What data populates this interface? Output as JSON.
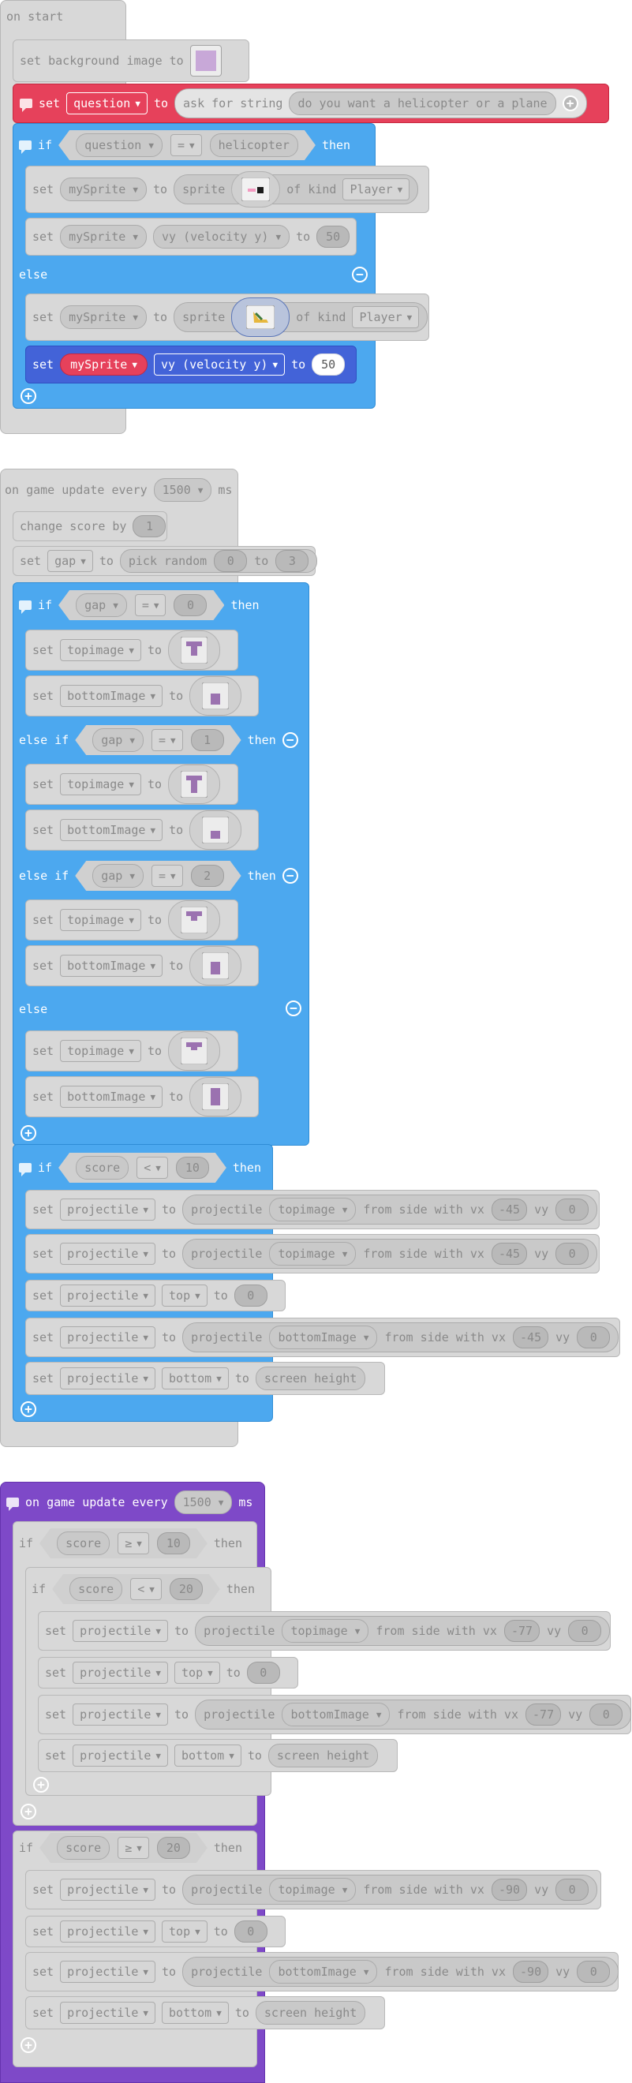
{
  "kw": {
    "set": "set",
    "to": "to",
    "if": "if",
    "then": "then",
    "else": "else",
    "else_if": "else if",
    "of_kind": "of kind",
    "sprite": "sprite",
    "change_score_by": "change score by",
    "pick_random": "pick random",
    "projectile": "projectile",
    "from_side_with_vx": "from side with vx",
    "vy": "vy",
    "screen_height": "screen height",
    "ms": "ms",
    "on_game_update_every": "on game update every"
  },
  "on_start": {
    "label": "on start",
    "set_bg": "set background image to",
    "question_var": "question",
    "ask_for_string": "ask for string",
    "prompt": "do you want a helicopter or a plane",
    "cond_var": "question",
    "cond_op": "=",
    "cond_val": "helicopter",
    "sprite_var": "mySprite",
    "kind": "Player",
    "vy_prop": "vy (velocity y)",
    "vy_value": "50"
  },
  "update1": {
    "interval": "1500",
    "score_change": "1",
    "gap_var": "gap",
    "rand_min": "0",
    "rand_max": "3",
    "op_eq": "=",
    "gap_values": [
      "0",
      "1",
      "2"
    ],
    "top_var": "topimage",
    "bottom_var": "bottomImage",
    "score_var": "score",
    "op_lt": "<",
    "score_limit": "10",
    "proj_var": "projectile",
    "vx": "-45",
    "vy": "0",
    "top_prop": "top",
    "bottom_prop": "bottom",
    "top_value": "0"
  },
  "update2": {
    "interval": "1500",
    "score_var": "score",
    "op_ge": "≥",
    "op_lt": "<",
    "ge_value": "10",
    "lt_value": "20",
    "ge_value2": "20",
    "proj_var": "projectile",
    "top_img": "topimage",
    "bottom_img": "bottomImage",
    "vx_inner": "-77",
    "vx_outer": "-90",
    "vy": "0",
    "top_prop": "top",
    "bottom_prop": "bottom",
    "top_value": "0"
  },
  "icons": {
    "plus": "⊕",
    "minus": "⊖",
    "caret": "▼"
  },
  "colors": {
    "events_gray": "#d8d8d8",
    "logic_blue": "#4ca8ef",
    "purple": "#7e49c8",
    "red": "#e6415b",
    "royal": "#4363d8"
  }
}
